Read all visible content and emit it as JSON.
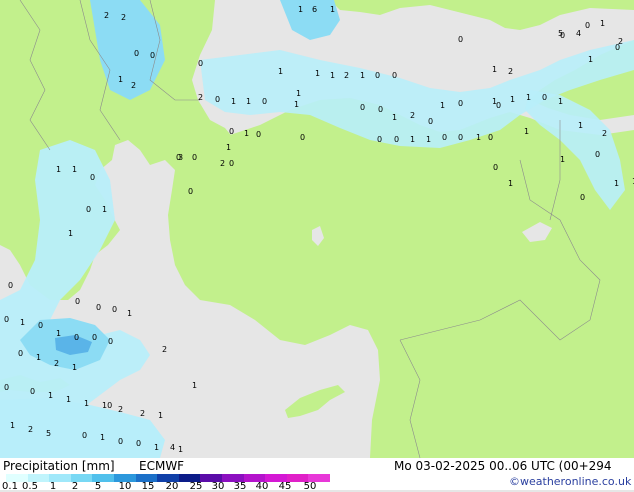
{
  "footer": {
    "label": "Precipitation [mm]",
    "model": "ECMWF",
    "datetime": "Mo 03-02-2025 00..06 UTC (00+294",
    "credit": "©weatheronline.co.uk"
  },
  "legend": {
    "ticks": [
      "0.1",
      "0.5",
      "1",
      "2",
      "5",
      "10",
      "15",
      "20",
      "25",
      "30",
      "35",
      "40",
      "45",
      "50"
    ],
    "colors": [
      "#e0ffff",
      "#c0f4fc",
      "#a0e8fa",
      "#78d8f4",
      "#50c0ec",
      "#2c98dc",
      "#1c70c8",
      "#1040a8",
      "#0c1c88",
      "#5a0ca8",
      "#8c10c0",
      "#b414cc",
      "#d418d4",
      "#e020c8",
      "#e838d8"
    ]
  },
  "map_colors": {
    "land": "#c2f08c",
    "sea": "#e6e6e6",
    "border": "#8c8c8c",
    "precip_light": "#b8eefa",
    "precip_mid": "#8cdcf4",
    "precip_heavy": "#5ab4e8"
  },
  "map_values": [
    {
      "text": "2"
    },
    {
      "text": "2"
    },
    {
      "text": "6"
    },
    {
      "text": "1"
    },
    {
      "text": "1"
    },
    {
      "text": "0"
    },
    {
      "text": "0"
    },
    {
      "text": "2"
    },
    {
      "text": "1"
    },
    {
      "text": "0"
    },
    {
      "text": "1"
    },
    {
      "text": "1"
    },
    {
      "text": "1"
    },
    {
      "text": "2"
    },
    {
      "text": "1"
    },
    {
      "text": "0"
    },
    {
      "text": "0"
    },
    {
      "text": "2"
    },
    {
      "text": "0"
    },
    {
      "text": "1"
    },
    {
      "text": "1"
    },
    {
      "text": "0"
    },
    {
      "text": "1"
    },
    {
      "text": "0"
    },
    {
      "text": "0"
    },
    {
      "text": "1"
    },
    {
      "text": "0"
    },
    {
      "text": "1"
    },
    {
      "text": "1"
    },
    {
      "text": "1"
    },
    {
      "text": "0"
    },
    {
      "text": "1"
    },
    {
      "text": "0"
    },
    {
      "text": "0"
    },
    {
      "text": "1"
    },
    {
      "text": "1"
    },
    {
      "text": "0"
    },
    {
      "text": "0"
    },
    {
      "text": "1"
    },
    {
      "text": "0"
    },
    {
      "text": "1"
    },
    {
      "text": "0"
    },
    {
      "text": "1"
    },
    {
      "text": "1"
    },
    {
      "text": "0"
    },
    {
      "text": "1"
    },
    {
      "text": "0"
    },
    {
      "text": "1"
    },
    {
      "text": "2"
    },
    {
      "text": "0"
    },
    {
      "text": "3"
    },
    {
      "text": "0"
    },
    {
      "text": "0"
    },
    {
      "text": "0"
    },
    {
      "text": "1"
    },
    {
      "text": "1"
    },
    {
      "text": "0"
    },
    {
      "text": "1"
    },
    {
      "text": "0"
    },
    {
      "text": "1"
    },
    {
      "text": "0"
    },
    {
      "text": "0"
    },
    {
      "text": "0"
    },
    {
      "text": "0"
    },
    {
      "text": "1"
    },
    {
      "text": "0"
    },
    {
      "text": "1"
    },
    {
      "text": "0"
    },
    {
      "text": "1"
    },
    {
      "text": "0"
    },
    {
      "text": "0"
    },
    {
      "text": "0"
    },
    {
      "text": "2"
    },
    {
      "text": "0"
    },
    {
      "text": "1"
    },
    {
      "text": "2"
    },
    {
      "text": "1"
    },
    {
      "text": "0"
    },
    {
      "text": "0"
    },
    {
      "text": "1"
    },
    {
      "text": "1"
    },
    {
      "text": "1"
    },
    {
      "text": "10"
    },
    {
      "text": "2"
    },
    {
      "text": "2"
    },
    {
      "text": "1"
    },
    {
      "text": "1"
    },
    {
      "text": "2"
    },
    {
      "text": "5"
    },
    {
      "text": "0"
    },
    {
      "text": "1"
    },
    {
      "text": "0"
    },
    {
      "text": "0"
    },
    {
      "text": "1"
    },
    {
      "text": "4"
    },
    {
      "text": "1"
    },
    {
      "text": "1"
    },
    {
      "text": "0"
    },
    {
      "text": "0"
    },
    {
      "text": "1"
    },
    {
      "text": "0"
    },
    {
      "text": "1"
    },
    {
      "text": "1"
    },
    {
      "text": "2"
    },
    {
      "text": "5"
    },
    {
      "text": "4"
    },
    {
      "text": "2"
    },
    {
      "text": "0"
    },
    {
      "text": "0"
    },
    {
      "text": "1"
    },
    {
      "text": "1"
    },
    {
      "text": "2"
    },
    {
      "text": "1"
    },
    {
      "text": "0"
    },
    {
      "text": "0"
    },
    {
      "text": "1"
    },
    {
      "text": "2"
    },
    {
      "text": "0"
    },
    {
      "text": "1"
    },
    {
      "text": "0"
    },
    {
      "text": "0"
    },
    {
      "text": "0"
    }
  ]
}
